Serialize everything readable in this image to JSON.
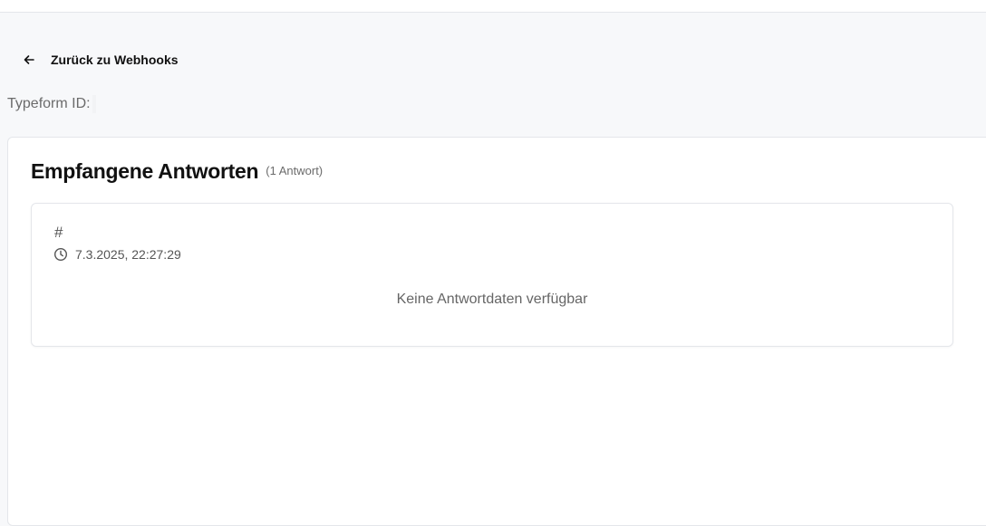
{
  "header": {
    "back_link": {
      "label": "Zurück zu Webhooks",
      "icon": "arrow-left-icon"
    }
  },
  "typeform": {
    "label": "Typeform ID:",
    "value": ""
  },
  "responses_card": {
    "title": "Empfangene Antworten",
    "count": "(1 Antwort)",
    "items": [
      {
        "id": "#",
        "timestamp_icon": "clock-icon",
        "timestamp": "7.3.2025, 22:27:29",
        "empty_message": "Keine Antwortdaten verfügbar"
      }
    ]
  },
  "colors": {
    "page_background": "#f7f8fa",
    "card_background": "#ffffff",
    "border": "#e4e6ea",
    "muted_text": "#6b6b6b"
  }
}
